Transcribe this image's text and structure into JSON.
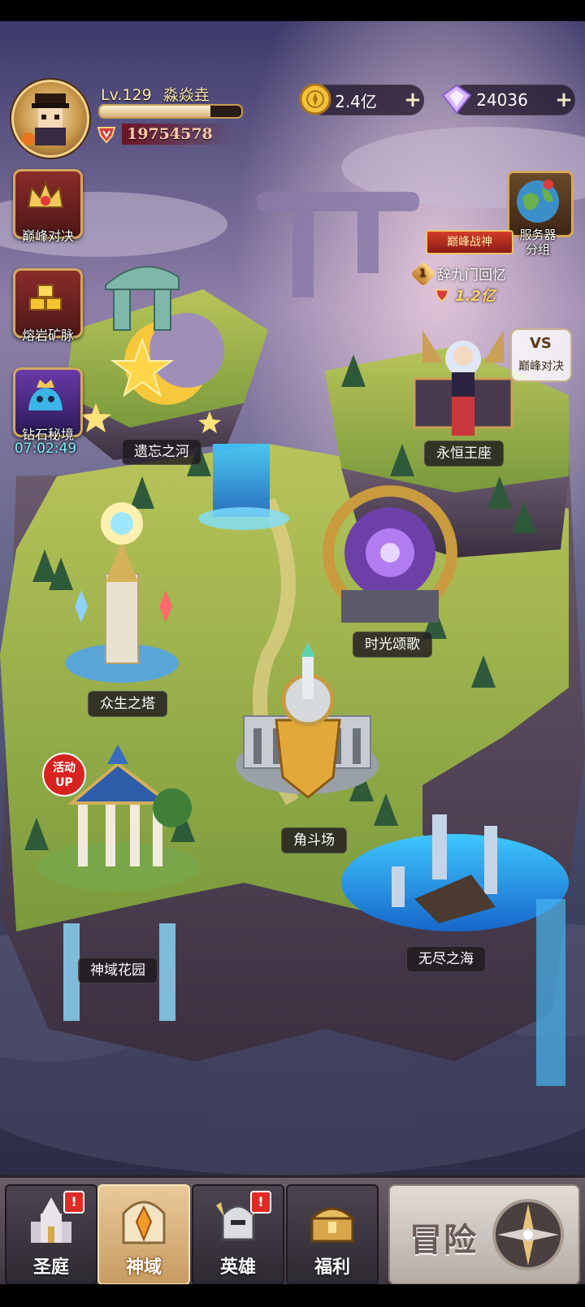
{
  "player": {
    "level": "Lv.129",
    "name": "淼焱垚",
    "exp_fraction": 0.78,
    "power": "19754578"
  },
  "resources": {
    "gold": "2.4亿",
    "diamond": "24036"
  },
  "side_buttons": [
    {
      "label": "巅峰对决",
      "icon": "crown-icon"
    },
    {
      "label": "熔岩矿脉",
      "icon": "gold-bars-icon"
    },
    {
      "label": "钻石秘境",
      "icon": "slime-king-icon",
      "timer": "07:02:49"
    }
  ],
  "server_button": {
    "label_line1": "服务器",
    "label_line2": "分组",
    "icon": "globe-icon"
  },
  "champion": {
    "ribbon": "巅峰战神",
    "rank": "1",
    "name": "辞九门回忆",
    "power": "1.2亿"
  },
  "vs_badge": {
    "vs": "VS",
    "label": "巅峰对决"
  },
  "event_badge": {
    "line1": "活动",
    "line2": "UP"
  },
  "locations": [
    {
      "label": "遗忘之河"
    },
    {
      "label": "永恒王座"
    },
    {
      "label": "时光颂歌"
    },
    {
      "label": "众生之塔"
    },
    {
      "label": "角斗场"
    },
    {
      "label": "神域花园"
    },
    {
      "label": "无尽之海"
    }
  ],
  "nav": {
    "tabs": [
      {
        "label": "圣庭",
        "alert": "!",
        "icon": "cathedral-icon"
      },
      {
        "label": "神域",
        "alert": "",
        "icon": "crystal-gate-icon",
        "active": true
      },
      {
        "label": "英雄",
        "alert": "!",
        "icon": "helmet-icon"
      },
      {
        "label": "福利",
        "alert": "",
        "icon": "treasure-chest-icon"
      }
    ],
    "adventure": "冒险"
  },
  "colors": {
    "accent_gold": "#d5a85c",
    "alert_red": "#e02a24",
    "timer_cyan": "#7ff0ff"
  }
}
